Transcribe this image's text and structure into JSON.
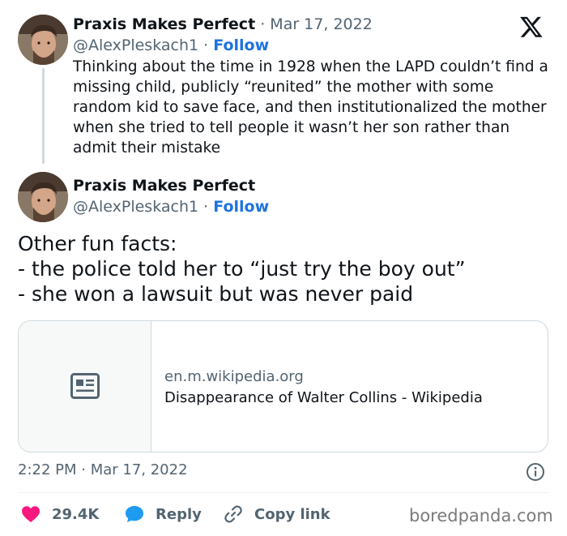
{
  "quoted_tweet": {
    "author_name": "Praxis Makes Perfect",
    "date": "Mar 17, 2022",
    "handle": "@AlexPleskach1",
    "follow_label": "Follow",
    "text": "Thinking about the time in 1928 when the LAPD couldn’t find a missing child, publicly “reunited” the mother with some random kid to save face, and then institutionalized the mother when she tried to tell people it wasn’t her son rather than admit their mistake"
  },
  "main_tweet": {
    "author_name": "Praxis Makes Perfect",
    "handle": "@AlexPleskach1",
    "follow_label": "Follow",
    "lines": [
      "Other fun facts:",
      "- the police told her to “just try the boy out”",
      "- she won a lawsuit but was never paid"
    ],
    "link_card": {
      "domain": "en.m.wikipedia.org",
      "title": "Disappearance of Walter Collins - Wikipedia",
      "icon": "article-icon"
    },
    "timestamp": "2:22 PM · Mar 17, 2022"
  },
  "actions": {
    "like_count": "29.4K",
    "reply_label": "Reply",
    "copy_link_label": "Copy link"
  },
  "watermark": "boredpanda.com",
  "colors": {
    "accent": "#1d73e0",
    "like": "#f91880",
    "muted": "#536471"
  }
}
